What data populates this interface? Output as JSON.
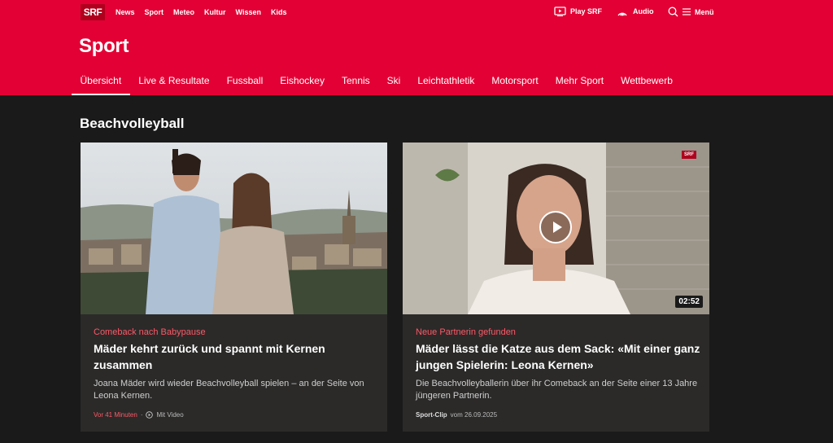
{
  "brand": {
    "logo": "SRF",
    "color": "#e30034"
  },
  "topnav": [
    "News",
    "Sport",
    "Meteo",
    "Kultur",
    "Wissen",
    "Kids"
  ],
  "utility": {
    "play": "Play SRF",
    "audio": "Audio",
    "menu": "Menü"
  },
  "section": {
    "title": "Sport"
  },
  "subnav": {
    "active": "Übersicht",
    "tabs": [
      "Übersicht",
      "Live & Resultate",
      "Fussball",
      "Eishockey",
      "Tennis",
      "Ski",
      "Leichtathletik",
      "Motorsport",
      "Mehr Sport",
      "Wettbewerb"
    ]
  },
  "main": {
    "heading": "Beachvolleyball",
    "cards": [
      {
        "kicker": "Comeback nach Babypause",
        "headline": "Mäder kehrt zurück und spannt mit Kernen zusammen",
        "lead": "Joana Mäder wird wieder Beachvolleyball spielen – an der Seite von Leona Kernen.",
        "time": "Vor 41 Minuten",
        "badge": "Mit Video"
      },
      {
        "kicker": "Neue Partnerin gefunden",
        "headline": "Mäder lässt die Katze aus dem Sack: «Mit einer ganz jungen Spielerin: Leona Kernen»",
        "lead": "Die Beachvolleyballerin über ihr Comeback an der Seite einer 13 Jahre jüngeren Partnerin.",
        "source": "Sport-Clip",
        "date": "vom 26.09.2025",
        "duration": "02:52",
        "watermark": "SRF"
      }
    ]
  }
}
